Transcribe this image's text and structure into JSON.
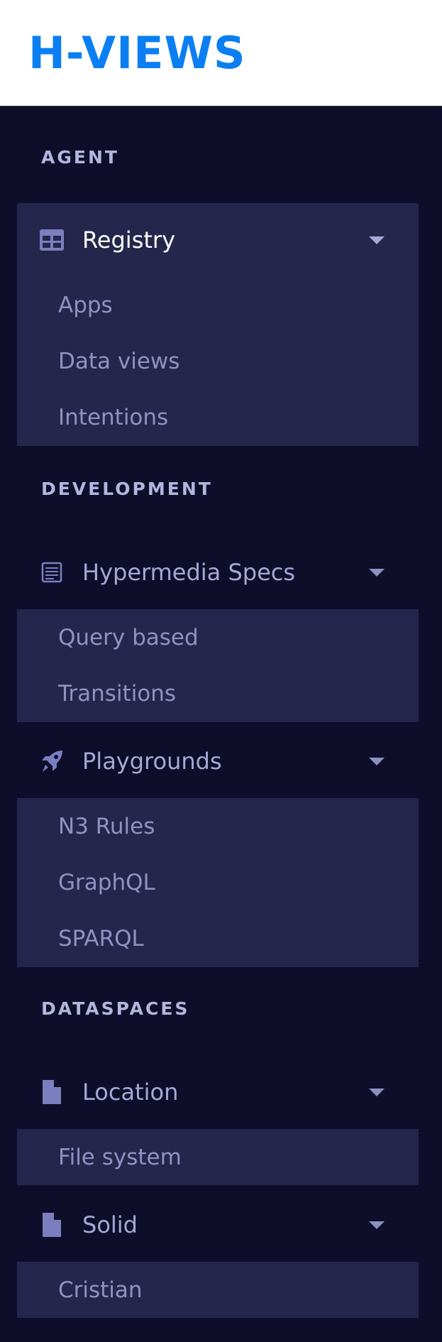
{
  "brand": "H-VIEWS",
  "sections": {
    "agent": "AGENT",
    "development": "DEVELOPMENT",
    "dataspaces": "DATASPACES"
  },
  "menus": {
    "registry": {
      "label": "Registry",
      "icon": "table-icon",
      "items": [
        "Apps",
        "Data views",
        "Intentions"
      ]
    },
    "hypermedia": {
      "label": "Hypermedia Specs",
      "icon": "spec-sheet-icon",
      "items": [
        "Query based",
        "Transitions"
      ]
    },
    "playgrounds": {
      "label": "Playgrounds",
      "icon": "rocket-icon",
      "items": [
        "N3 Rules",
        "GraphQL",
        "SPARQL"
      ]
    },
    "location": {
      "label": "Location",
      "icon": "file-icon",
      "items": [
        "File system"
      ]
    },
    "solid": {
      "label": "Solid",
      "icon": "file-icon",
      "items": [
        "Cristian"
      ]
    }
  },
  "colors": {
    "brand": "#0b7ff2",
    "sidebar_bg": "#0f0e2a",
    "submenu_bg": "#24264b",
    "section_title": "#b3b6de",
    "menu_text": "#a6a9d7",
    "icon": "#7b7fc0"
  }
}
